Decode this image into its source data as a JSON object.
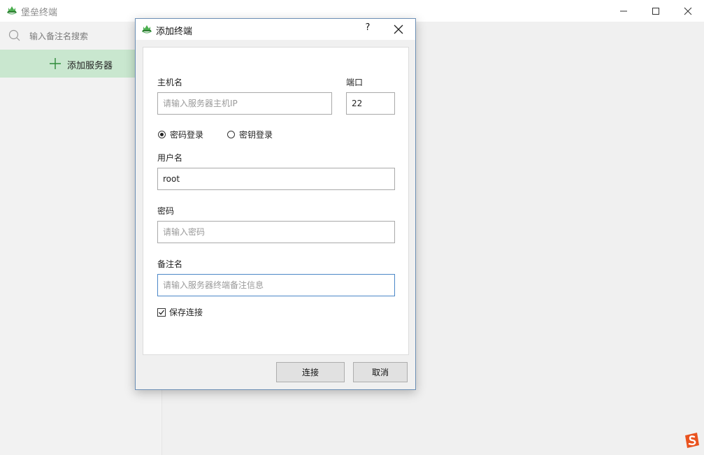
{
  "window": {
    "title": "堡垒终端",
    "icon": "leaf-logo-icon"
  },
  "sidebar": {
    "search_placeholder": "输入备注名搜索",
    "add_server_label": "添加服务器"
  },
  "dialog": {
    "title": "添加终端",
    "help_label": "?",
    "hostname_label": "主机名",
    "hostname_placeholder": "请输入服务器主机IP",
    "port_label": "端口",
    "port_value": "22",
    "auth_password_label": "密码登录",
    "auth_key_label": "密钥登录",
    "auth_selected": "密码登录",
    "username_label": "用户名",
    "username_value": "root",
    "password_label": "密码",
    "password_placeholder": "请输入密码",
    "remark_label": "备注名",
    "remark_placeholder": "请输入服务器终端备注信息",
    "save_connection_label": "保存连接",
    "save_connection_checked": true,
    "connect_button": "连接",
    "cancel_button": "取消"
  },
  "colors": {
    "accent_green": "#c9e7cf",
    "focus_border": "#4b87c7",
    "sogou_orange": "#e9531f"
  }
}
